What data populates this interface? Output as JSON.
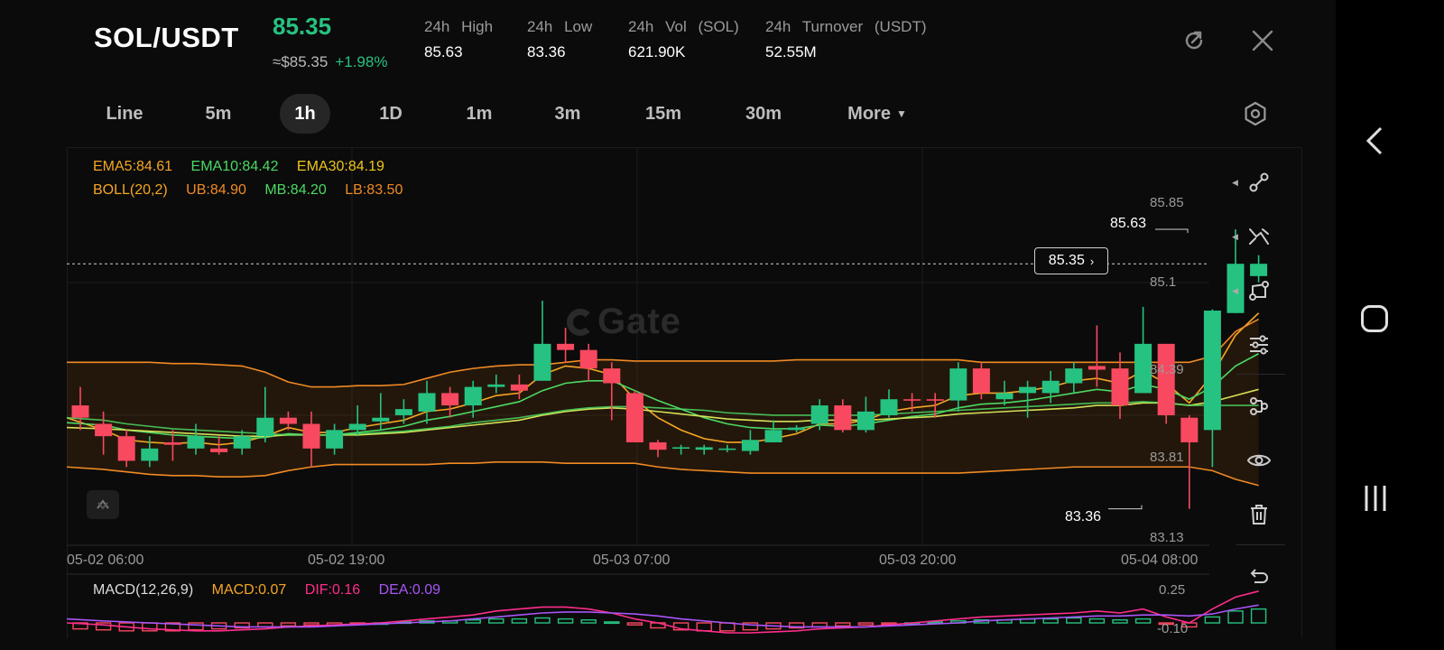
{
  "header": {
    "pair": "SOL/USDT",
    "price": "85.35",
    "usd_price": "≈$85.35",
    "change": "+1.98%",
    "stats": [
      {
        "label": "24h High",
        "value": "85.63"
      },
      {
        "label": "24h Low",
        "value": "83.36"
      },
      {
        "label": "24h Vol (SOL)",
        "value": "621.90K"
      },
      {
        "label": "24h Turnover (USDT)",
        "value": "52.55M"
      }
    ]
  },
  "timeframes": [
    {
      "label": "Line",
      "active": false
    },
    {
      "label": "5m",
      "active": false
    },
    {
      "label": "1h",
      "active": true
    },
    {
      "label": "1D",
      "active": false
    },
    {
      "label": "1m",
      "active": false
    },
    {
      "label": "3m",
      "active": false
    },
    {
      "label": "15m",
      "active": false
    },
    {
      "label": "30m",
      "active": false
    },
    {
      "label": "More",
      "active": false
    }
  ],
  "indicators": {
    "ema5": "EMA5:84.61",
    "ema10": "EMA10:84.42",
    "ema30": "EMA30:84.19",
    "boll": "BOLL(20,2)",
    "ub": "UB:84.90",
    "mb": "MB:84.20",
    "lb": "LB:83.50"
  },
  "macd": {
    "title": "MACD(12,26,9)",
    "macd": "MACD:0.07",
    "dif": "DIF:0.16",
    "dea": "DEA:0.09",
    "y_top": "0.25",
    "y_bottom": "-0.10"
  },
  "watermark": "Gate",
  "current_price_badge": "85.35",
  "high_marker": "85.63",
  "low_marker": "83.36",
  "y_axis_labels": [
    "85.85",
    "85.1",
    "84.39",
    "83.81",
    "83.13"
  ],
  "x_axis_labels": [
    "05-02 06:00",
    "05-02 19:00",
    "05-03 07:00",
    "05-03 20:00",
    "05-04 08:00"
  ],
  "tools": [
    "line-draw-icon",
    "cross-lines-icon",
    "shape-icon",
    "sliders-icon",
    "pattern-icon",
    "eye-icon",
    "trash-icon",
    "undo-icon"
  ],
  "colors": {
    "up": "#26c281",
    "down": "#f84960",
    "ema5": "#f5a623",
    "ema10": "#4cd964",
    "ema30": "#d4e157",
    "boll": "#f08a24",
    "dif": "#ff2d8c",
    "dea": "#a855f7"
  },
  "chart_data": {
    "type": "candlestick",
    "ylim": [
      83.13,
      85.85
    ],
    "candles": [
      [
        84.2,
        84.1,
        84.35,
        84.0
      ],
      [
        84.05,
        83.95,
        84.15,
        83.8
      ],
      [
        83.95,
        83.75,
        84.0,
        83.7
      ],
      [
        83.75,
        83.85,
        83.95,
        83.7
      ],
      [
        83.9,
        83.88,
        84.0,
        83.75
      ],
      [
        83.85,
        83.95,
        84.05,
        83.8
      ],
      [
        83.85,
        83.82,
        83.95,
        83.8
      ],
      [
        83.85,
        83.95,
        84.0,
        83.8
      ],
      [
        83.95,
        84.1,
        84.35,
        83.9
      ],
      [
        84.1,
        84.05,
        84.15,
        84.0
      ],
      [
        84.05,
        83.85,
        84.15,
        83.7
      ],
      [
        83.85,
        84.0,
        84.05,
        83.8
      ],
      [
        84.0,
        84.05,
        84.2,
        83.95
      ],
      [
        84.07,
        84.1,
        84.3,
        84.0
      ],
      [
        84.12,
        84.17,
        84.25,
        84.05
      ],
      [
        84.15,
        84.3,
        84.4,
        84.05
      ],
      [
        84.3,
        84.2,
        84.35,
        84.1
      ],
      [
        84.2,
        84.35,
        84.4,
        84.1
      ],
      [
        84.35,
        84.37,
        84.45,
        84.3
      ],
      [
        84.37,
        84.32,
        84.45,
        84.25
      ],
      [
        84.4,
        84.7,
        85.05,
        84.4
      ],
      [
        84.7,
        84.65,
        84.83,
        84.55
      ],
      [
        84.65,
        84.5,
        84.7,
        84.4
      ],
      [
        84.5,
        84.38,
        84.55,
        84.08
      ],
      [
        84.3,
        83.9,
        84.32,
        83.9
      ],
      [
        83.9,
        83.84,
        83.92,
        83.78
      ],
      [
        83.85,
        83.86,
        83.88,
        83.8
      ],
      [
        83.84,
        83.86,
        83.88,
        83.8
      ],
      [
        83.84,
        83.85,
        83.88,
        83.82
      ],
      [
        83.83,
        83.92,
        84.0,
        83.8
      ],
      [
        83.9,
        84.0,
        84.08,
        83.9
      ],
      [
        84.0,
        84.02,
        84.04,
        83.98
      ],
      [
        84.05,
        84.2,
        84.25,
        84.0
      ],
      [
        84.2,
        84.0,
        84.25,
        83.98
      ],
      [
        84.0,
        84.15,
        84.27,
        83.98
      ],
      [
        84.12,
        84.25,
        84.33,
        84.1
      ],
      [
        84.25,
        84.24,
        84.3,
        84.15
      ],
      [
        84.25,
        84.24,
        84.3,
        84.1
      ],
      [
        84.24,
        84.5,
        84.55,
        84.15
      ],
      [
        84.5,
        84.3,
        84.55,
        84.25
      ],
      [
        84.25,
        84.3,
        84.4,
        84.2
      ],
      [
        84.3,
        84.35,
        84.4,
        84.1
      ],
      [
        84.3,
        84.4,
        84.48,
        84.22
      ],
      [
        84.38,
        84.5,
        84.55,
        84.3
      ],
      [
        84.52,
        84.49,
        84.85,
        84.35
      ],
      [
        84.5,
        84.2,
        84.63,
        84.09
      ],
      [
        84.3,
        84.7,
        85.0,
        84.3
      ],
      [
        84.7,
        84.12,
        84.7,
        84.05
      ],
      [
        84.1,
        83.9,
        84.12,
        83.36
      ],
      [
        84.0,
        84.97,
        84.98,
        83.7
      ],
      [
        84.95,
        85.35,
        85.63,
        84.95
      ],
      [
        85.25,
        85.35,
        85.42,
        85.2
      ]
    ],
    "series": [
      {
        "name": "EMA5",
        "values": [
          84.1,
          84.0,
          83.92,
          83.9,
          83.89,
          83.9,
          83.88,
          83.9,
          83.95,
          84.02,
          83.98,
          83.98,
          84.02,
          84.05,
          84.08,
          84.15,
          84.17,
          84.22,
          84.28,
          84.3,
          84.45,
          84.52,
          84.5,
          84.45,
          84.25,
          84.1,
          84.0,
          83.93,
          83.9,
          83.9,
          83.93,
          83.97,
          84.05,
          84.05,
          84.08,
          84.15,
          84.18,
          84.2,
          84.28,
          84.3,
          84.3,
          84.32,
          84.35,
          84.4,
          84.42,
          84.38,
          84.48,
          84.38,
          84.22,
          84.45,
          84.77,
          84.95
        ]
      },
      {
        "name": "EMA10",
        "values": [
          84.06,
          84.04,
          84.0,
          83.98,
          83.96,
          83.95,
          83.94,
          83.93,
          83.94,
          83.97,
          83.96,
          83.96,
          83.98,
          84.0,
          84.03,
          84.08,
          84.11,
          84.15,
          84.19,
          84.23,
          84.32,
          84.38,
          84.4,
          84.4,
          84.32,
          84.24,
          84.17,
          84.1,
          84.05,
          84.02,
          84.01,
          84.01,
          84.04,
          84.03,
          84.05,
          84.08,
          84.11,
          84.13,
          84.18,
          84.21,
          84.22,
          84.24,
          84.27,
          84.3,
          84.33,
          84.31,
          84.37,
          84.33,
          84.25,
          84.35,
          84.52,
          84.62
        ]
      },
      {
        "name": "EMA30",
        "values": [
          84.02,
          84.01,
          84.0,
          83.99,
          83.98,
          83.97,
          83.96,
          83.95,
          83.95,
          83.96,
          83.96,
          83.96,
          83.96,
          83.97,
          83.98,
          84.0,
          84.02,
          84.04,
          84.06,
          84.08,
          84.12,
          84.15,
          84.17,
          84.18,
          84.17,
          84.15,
          84.13,
          84.11,
          84.09,
          84.08,
          84.07,
          84.07,
          84.08,
          84.08,
          84.08,
          84.09,
          84.1,
          84.11,
          84.13,
          84.14,
          84.15,
          84.16,
          84.17,
          84.18,
          84.2,
          84.2,
          84.22,
          84.22,
          84.2,
          84.23,
          84.28,
          84.33
        ]
      },
      {
        "name": "UB",
        "values": [
          84.55,
          84.55,
          84.55,
          84.55,
          84.54,
          84.54,
          84.53,
          84.52,
          84.47,
          84.39,
          84.35,
          84.35,
          84.36,
          84.36,
          84.37,
          84.42,
          84.47,
          84.5,
          84.52,
          84.53,
          84.53,
          84.55,
          84.57,
          84.57,
          84.56,
          84.56,
          84.56,
          84.56,
          84.56,
          84.56,
          84.56,
          84.57,
          84.57,
          84.57,
          84.57,
          84.57,
          84.57,
          84.57,
          84.57,
          84.55,
          84.55,
          84.55,
          84.55,
          84.55,
          84.55,
          84.55,
          84.55,
          84.55,
          84.55,
          84.6,
          84.8,
          84.9
        ]
      },
      {
        "name": "MB",
        "values": [
          84.1,
          84.08,
          84.05,
          84.03,
          84.01,
          84.0,
          83.99,
          83.98,
          83.97,
          83.96,
          83.96,
          83.96,
          83.97,
          83.98,
          83.99,
          84.01,
          84.03,
          84.06,
          84.08,
          84.1,
          84.13,
          84.16,
          84.18,
          84.19,
          84.19,
          84.18,
          84.17,
          84.16,
          84.14,
          84.13,
          84.12,
          84.12,
          84.12,
          84.12,
          84.12,
          84.13,
          84.14,
          84.15,
          84.16,
          84.17,
          84.18,
          84.19,
          84.2,
          84.21,
          84.22,
          84.22,
          84.23,
          84.22,
          84.2,
          84.2,
          84.2,
          84.2
        ]
      },
      {
        "name": "LB",
        "values": [
          83.7,
          83.68,
          83.66,
          83.64,
          83.63,
          83.63,
          83.62,
          83.62,
          83.63,
          83.67,
          83.7,
          83.72,
          83.72,
          83.72,
          83.72,
          83.72,
          83.73,
          83.73,
          83.74,
          83.74,
          83.74,
          83.73,
          83.73,
          83.73,
          83.73,
          83.7,
          83.68,
          83.67,
          83.66,
          83.65,
          83.65,
          83.65,
          83.65,
          83.65,
          83.65,
          83.65,
          83.65,
          83.65,
          83.65,
          83.66,
          83.67,
          83.68,
          83.69,
          83.7,
          83.7,
          83.7,
          83.7,
          83.7,
          83.7,
          83.67,
          83.6,
          83.55
        ]
      }
    ],
    "macd_hist": [
      -0.03,
      -0.035,
      -0.04,
      -0.04,
      -0.04,
      -0.035,
      -0.03,
      -0.025,
      -0.02,
      -0.015,
      -0.01,
      -0.01,
      -0.005,
      0.0,
      0.005,
      0.01,
      0.01,
      0.015,
      0.02,
      0.02,
      0.025,
      0.02,
      0.015,
      0.005,
      -0.01,
      -0.025,
      -0.035,
      -0.04,
      -0.04,
      -0.035,
      -0.03,
      -0.025,
      -0.02,
      -0.015,
      -0.01,
      -0.005,
      0.0,
      0.005,
      0.01,
      0.015,
      0.015,
      0.02,
      0.02,
      0.025,
      0.02,
      0.015,
      0.02,
      -0.005,
      -0.02,
      0.03,
      0.06,
      0.07
    ],
    "dif": [
      0.0,
      -0.01,
      -0.02,
      -0.03,
      -0.035,
      -0.04,
      -0.04,
      -0.035,
      -0.03,
      -0.02,
      -0.015,
      -0.01,
      -0.005,
      0.0,
      0.01,
      0.02,
      0.03,
      0.04,
      0.06,
      0.07,
      0.08,
      0.08,
      0.07,
      0.05,
      0.02,
      0.0,
      -0.03,
      -0.04,
      -0.05,
      -0.05,
      -0.045,
      -0.04,
      -0.03,
      -0.025,
      -0.02,
      -0.01,
      0.0,
      0.01,
      0.02,
      0.03,
      0.035,
      0.04,
      0.045,
      0.05,
      0.06,
      0.05,
      0.07,
      0.03,
      0.0,
      0.07,
      0.13,
      0.16
    ],
    "dea": [
      0.02,
      0.01,
      0.005,
      0.0,
      -0.005,
      -0.01,
      -0.015,
      -0.02,
      -0.02,
      -0.02,
      -0.02,
      -0.015,
      -0.01,
      -0.005,
      0.0,
      0.005,
      0.01,
      0.02,
      0.03,
      0.04,
      0.05,
      0.055,
      0.055,
      0.05,
      0.045,
      0.035,
      0.02,
      0.01,
      0.0,
      -0.01,
      -0.015,
      -0.02,
      -0.02,
      -0.02,
      -0.02,
      -0.015,
      -0.01,
      -0.005,
      0.0,
      0.01,
      0.015,
      0.02,
      0.025,
      0.03,
      0.035,
      0.035,
      0.04,
      0.04,
      0.035,
      0.045,
      0.07,
      0.09
    ]
  }
}
